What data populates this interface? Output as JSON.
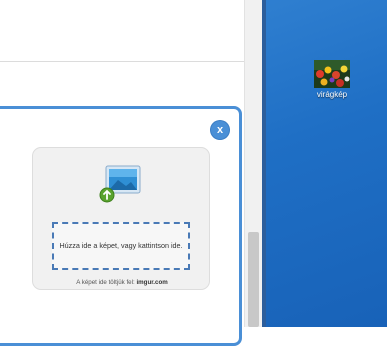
{
  "dialog": {
    "close_label": "x",
    "drop_zone_text": "Húzza ide a képet, vagy kattintson ide.",
    "footer_prefix": "A képet ide töltjük fel: ",
    "footer_site": "imgur.com"
  },
  "desktop": {
    "file_icon_label": "virágkép"
  },
  "colors": {
    "accent_blue": "#4a8fd6",
    "desktop_blue": "#1f6fc5"
  }
}
